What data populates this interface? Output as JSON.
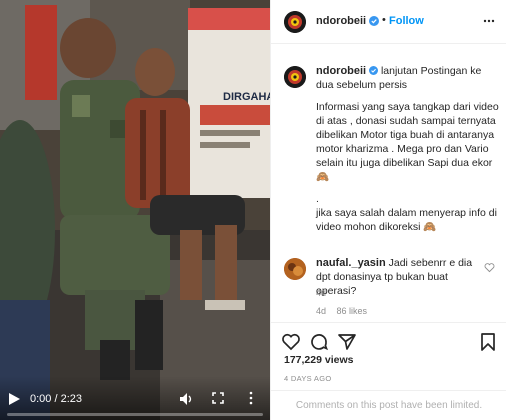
{
  "video": {
    "background_banner_text": "DIRGAHAYU",
    "current_time": "0:00",
    "duration": "2:23",
    "time_label": "0:00 / 2:23",
    "progress_fraction": 0,
    "icons": [
      "play-icon",
      "volume-icon",
      "fullscreen-icon",
      "more-vertical-icon"
    ]
  },
  "header": {
    "username": "ndorobeii",
    "separator": "•",
    "follow_label": "Follow",
    "verified": true
  },
  "caption": {
    "username": "ndorobeii",
    "first_line": "lanjutan Postingan ke dua sebelum persis",
    "paragraph_1": "Informasi yang saya tangkap dari video di atas , donasi sudah sampai ternyata dibelikan Motor tiga buah di antaranya motor kharizma . Mega pro dan Vario selain itu juga dibelikan Sapi dua ekor 🙈",
    "paragraph_2": ".",
    "paragraph_3": "jika saya salah dalam menyerap info di video mohon dikoreksi 🙈",
    "time": "4d"
  },
  "comment": {
    "username": "naufal._yasin",
    "text": "Jadi sebenrr e dia dpt donasinya tp bukan buat operasi?",
    "time": "4d",
    "likes": "86 likes"
  },
  "stats": {
    "views": "177,229 views",
    "date": "4 DAYS AGO"
  },
  "footer": {
    "limited_text": "Comments on this post have been limited."
  },
  "colors": {
    "accent": "#0095f6",
    "verified": "#3897f0",
    "muted": "#8e8e8e",
    "text": "#262626"
  }
}
